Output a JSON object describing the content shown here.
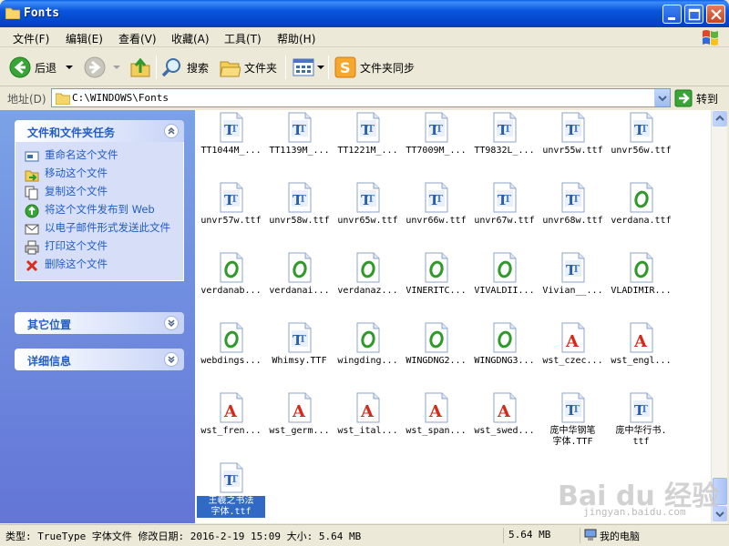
{
  "window": {
    "title": "Fonts"
  },
  "menu": [
    {
      "label": "文件(F)"
    },
    {
      "label": "编辑(E)"
    },
    {
      "label": "查看(V)"
    },
    {
      "label": "收藏(A)"
    },
    {
      "label": "工具(T)"
    },
    {
      "label": "帮助(H)"
    }
  ],
  "toolbar": {
    "back": "后退",
    "search": "搜索",
    "folders": "文件夹",
    "sync": "文件夹同步"
  },
  "address": {
    "label": "地址(D)",
    "path": "C:\\WINDOWS\\Fonts",
    "go": "转到"
  },
  "tasks_panel": {
    "title": "文件和文件夹任务",
    "items": [
      {
        "label": "重命名这个文件",
        "icon": "rename-icon"
      },
      {
        "label": "移动这个文件",
        "icon": "move-icon"
      },
      {
        "label": "复制这个文件",
        "icon": "copy-icon"
      },
      {
        "label": "将这个文件发布到 Web",
        "icon": "publish-web-icon"
      },
      {
        "label": "以电子邮件形式发送此文件",
        "icon": "email-icon"
      },
      {
        "label": "打印这个文件",
        "icon": "print-icon"
      },
      {
        "label": "删除这个文件",
        "icon": "delete-icon"
      }
    ]
  },
  "other_places": {
    "title": "其它位置"
  },
  "details": {
    "title": "详细信息"
  },
  "files": [
    {
      "name": "TT1044M_...",
      "type": "tt"
    },
    {
      "name": "TT1139M_...",
      "type": "tt"
    },
    {
      "name": "TT1221M_...",
      "type": "tt"
    },
    {
      "name": "TT7009M_...",
      "type": "tt"
    },
    {
      "name": "TT9832L_...",
      "type": "tt"
    },
    {
      "name": "unvr55w.ttf",
      "type": "tt"
    },
    {
      "name": "unvr56w.ttf",
      "type": "tt"
    },
    {
      "name": "unvr57w.ttf",
      "type": "tt"
    },
    {
      "name": "unvr58w.ttf",
      "type": "tt"
    },
    {
      "name": "unvr65w.ttf",
      "type": "tt"
    },
    {
      "name": "unvr66w.ttf",
      "type": "tt"
    },
    {
      "name": "unvr67w.ttf",
      "type": "tt"
    },
    {
      "name": "unvr68w.ttf",
      "type": "tt"
    },
    {
      "name": "verdana.ttf",
      "type": "o"
    },
    {
      "name": "verdanab...",
      "type": "o"
    },
    {
      "name": "verdanai...",
      "type": "o"
    },
    {
      "name": "verdanaz...",
      "type": "o"
    },
    {
      "name": "VINERITC...",
      "type": "o"
    },
    {
      "name": "VIVALDII...",
      "type": "o"
    },
    {
      "name": "Vivian__...",
      "type": "tt"
    },
    {
      "name": "VLADIMIR...",
      "type": "o"
    },
    {
      "name": "webdings...",
      "type": "o"
    },
    {
      "name": "Whimsy.TTF",
      "type": "tt"
    },
    {
      "name": "wingding...",
      "type": "o"
    },
    {
      "name": "WINGDNG2...",
      "type": "o"
    },
    {
      "name": "WINGDNG3...",
      "type": "o"
    },
    {
      "name": "wst_czec...",
      "type": "a"
    },
    {
      "name": "wst_engl...",
      "type": "a"
    },
    {
      "name": "wst_fren...",
      "type": "a"
    },
    {
      "name": "wst_germ...",
      "type": "a"
    },
    {
      "name": "wst_ital...",
      "type": "a"
    },
    {
      "name": "wst_span...",
      "type": "a"
    },
    {
      "name": "wst_swed...",
      "type": "a"
    },
    {
      "name": "庞中华钢笔\n字体.TTF",
      "type": "tt"
    },
    {
      "name": "庞中华行书.\nttf",
      "type": "tt"
    },
    {
      "name": "王羲之书法\n字体.ttf",
      "type": "tt",
      "selected": true
    }
  ],
  "status": {
    "info": "类型: TrueType 字体文件 修改日期: 2016-2-19 15:09 大小: 5.64 MB",
    "size": "5.64 MB",
    "location": "我的电脑"
  },
  "watermark": {
    "main": "Bai du 经验",
    "sub": "jingyan.baidu.com"
  },
  "colors": {
    "titlebar": "#0a5fe5",
    "task_link": "#215dc6",
    "selection": "#316ac5",
    "left_pane": "#7ba2e7"
  }
}
